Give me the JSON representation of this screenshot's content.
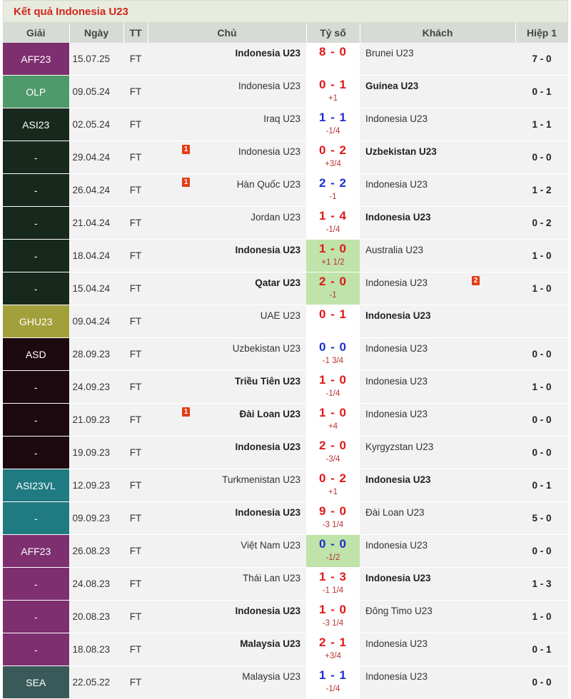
{
  "title": "Kết quả Indonesia U23",
  "headers": {
    "league": "Giải",
    "date": "Ngày",
    "status": "TT",
    "home": "Chủ",
    "score": "Tỷ số",
    "away": "Khách",
    "ht": "Hiệp 1"
  },
  "colors": {
    "title_red": "#d0261b",
    "score_red": "#e01818",
    "score_blue": "#1c2fd4",
    "win_highlight": "#bfe3a8"
  },
  "rows": [
    {
      "league": "AFF23",
      "league_color": "#7d2f6f",
      "date": "15.07.25",
      "status": "FT",
      "home": "Indonesia U23",
      "home_bold": true,
      "home_card": "",
      "score": "8 - 0",
      "score_color": "red",
      "handicap": "",
      "away": "Brunei U23",
      "away_bold": false,
      "away_card": "",
      "ht": "7 - 0",
      "win": false
    },
    {
      "league": "OLP",
      "league_color": "#4e9a6a",
      "date": "09.05.24",
      "status": "FT",
      "home": "Indonesia U23",
      "home_bold": false,
      "home_card": "",
      "score": "0 - 1",
      "score_color": "red",
      "handicap": "+1",
      "away": "Guinea U23",
      "away_bold": true,
      "away_card": "",
      "ht": "0 - 1",
      "win": false
    },
    {
      "league": "ASI23",
      "league_color": "#17291d",
      "date": "02.05.24",
      "status": "FT",
      "home": "Iraq U23",
      "home_bold": false,
      "home_card": "",
      "score": "1 - 1",
      "score_color": "blue",
      "handicap": "-1/4",
      "away": "Indonesia U23",
      "away_bold": false,
      "away_card": "",
      "ht": "1 - 1",
      "win": false
    },
    {
      "league": "-",
      "league_color": "#17291d",
      "date": "29.04.24",
      "status": "FT",
      "home": "Indonesia U23",
      "home_bold": false,
      "home_card": "1",
      "score": "0 - 2",
      "score_color": "red",
      "handicap": "+3/4",
      "away": "Uzbekistan U23",
      "away_bold": true,
      "away_card": "",
      "ht": "0 - 0",
      "win": false
    },
    {
      "league": "-",
      "league_color": "#17291d",
      "date": "26.04.24",
      "status": "FT",
      "home": "Hàn Quốc U23",
      "home_bold": false,
      "home_card": "1",
      "score": "2 - 2",
      "score_color": "blue",
      "handicap": "-1",
      "away": "Indonesia U23",
      "away_bold": false,
      "away_card": "",
      "ht": "1 - 2",
      "win": false
    },
    {
      "league": "-",
      "league_color": "#17291d",
      "date": "21.04.24",
      "status": "FT",
      "home": "Jordan U23",
      "home_bold": false,
      "home_card": "",
      "score": "1 - 4",
      "score_color": "red",
      "handicap": "-1/4",
      "away": "Indonesia U23",
      "away_bold": true,
      "away_card": "",
      "ht": "0 - 2",
      "win": false
    },
    {
      "league": "-",
      "league_color": "#17291d",
      "date": "18.04.24",
      "status": "FT",
      "home": "Indonesia U23",
      "home_bold": true,
      "home_card": "",
      "score": "1 - 0",
      "score_color": "red",
      "handicap": "+1 1/2",
      "away": "Australia U23",
      "away_bold": false,
      "away_card": "",
      "ht": "1 - 0",
      "win": true
    },
    {
      "league": "-",
      "league_color": "#17291d",
      "date": "15.04.24",
      "status": "FT",
      "home": "Qatar U23",
      "home_bold": true,
      "home_card": "",
      "score": "2 - 0",
      "score_color": "red",
      "handicap": "-1",
      "away": "Indonesia U23",
      "away_bold": false,
      "away_card": "2",
      "ht": "1 - 0",
      "win": true
    },
    {
      "league": "GHU23",
      "league_color": "#a2a03a",
      "date": "09.04.24",
      "status": "FT",
      "home": "UAE U23",
      "home_bold": false,
      "home_card": "",
      "score": "0 - 1",
      "score_color": "red",
      "handicap": "",
      "away": "Indonesia U23",
      "away_bold": true,
      "away_card": "",
      "ht": "",
      "win": false
    },
    {
      "league": "ASD",
      "league_color": "#1d0a11",
      "date": "28.09.23",
      "status": "FT",
      "home": "Uzbekistan U23",
      "home_bold": false,
      "home_card": "",
      "score": "0 - 0",
      "score_color": "blue",
      "handicap": "-1 3/4",
      "away": "Indonesia U23",
      "away_bold": false,
      "away_card": "",
      "ht": "0 - 0",
      "win": false
    },
    {
      "league": "-",
      "league_color": "#1d0a11",
      "date": "24.09.23",
      "status": "FT",
      "home": "Triều Tiên U23",
      "home_bold": true,
      "home_card": "",
      "score": "1 - 0",
      "score_color": "red",
      "handicap": "-1/4",
      "away": "Indonesia U23",
      "away_bold": false,
      "away_card": "",
      "ht": "1 - 0",
      "win": false
    },
    {
      "league": "-",
      "league_color": "#1d0a11",
      "date": "21.09.23",
      "status": "FT",
      "home": "Đài Loan U23",
      "home_bold": true,
      "home_card": "1",
      "score": "1 - 0",
      "score_color": "red",
      "handicap": "+4",
      "away": "Indonesia U23",
      "away_bold": false,
      "away_card": "",
      "ht": "0 - 0",
      "win": false
    },
    {
      "league": "-",
      "league_color": "#1d0a11",
      "date": "19.09.23",
      "status": "FT",
      "home": "Indonesia U23",
      "home_bold": true,
      "home_card": "",
      "score": "2 - 0",
      "score_color": "red",
      "handicap": "-3/4",
      "away": "Kyrgyzstan U23",
      "away_bold": false,
      "away_card": "",
      "ht": "0 - 0",
      "win": false
    },
    {
      "league": "ASI23VL",
      "league_color": "#1f7a82",
      "date": "12.09.23",
      "status": "FT",
      "home": "Turkmenistan U23",
      "home_bold": false,
      "home_card": "",
      "score": "0 - 2",
      "score_color": "red",
      "handicap": "+1",
      "away": "Indonesia U23",
      "away_bold": true,
      "away_card": "",
      "ht": "0 - 1",
      "win": false
    },
    {
      "league": "-",
      "league_color": "#1f7a82",
      "date": "09.09.23",
      "status": "FT",
      "home": "Indonesia U23",
      "home_bold": true,
      "home_card": "",
      "score": "9 - 0",
      "score_color": "red",
      "handicap": "-3 1/4",
      "away": "Đài Loan U23",
      "away_bold": false,
      "away_card": "",
      "ht": "5 - 0",
      "win": false
    },
    {
      "league": "AFF23",
      "league_color": "#7d2f6f",
      "date": "26.08.23",
      "status": "FT",
      "home": "Việt Nam U23",
      "home_bold": false,
      "home_card": "",
      "score": "0 - 0",
      "score_color": "blue",
      "handicap": "-1/2",
      "away": "Indonesia U23",
      "away_bold": false,
      "away_card": "",
      "ht": "0 - 0",
      "win": true
    },
    {
      "league": "-",
      "league_color": "#7d2f6f",
      "date": "24.08.23",
      "status": "FT",
      "home": "Thái Lan U23",
      "home_bold": false,
      "home_card": "",
      "score": "1 - 3",
      "score_color": "red",
      "handicap": "-1 1/4",
      "away": "Indonesia U23",
      "away_bold": true,
      "away_card": "",
      "ht": "1 - 3",
      "win": false
    },
    {
      "league": "-",
      "league_color": "#7d2f6f",
      "date": "20.08.23",
      "status": "FT",
      "home": "Indonesia U23",
      "home_bold": true,
      "home_card": "",
      "score": "1 - 0",
      "score_color": "red",
      "handicap": "-3 1/4",
      "away": "Đông Timo U23",
      "away_bold": false,
      "away_card": "",
      "ht": "1 - 0",
      "win": false
    },
    {
      "league": "-",
      "league_color": "#7d2f6f",
      "date": "18.08.23",
      "status": "FT",
      "home": "Malaysia U23",
      "home_bold": true,
      "home_card": "",
      "score": "2 - 1",
      "score_color": "red",
      "handicap": "+3/4",
      "away": "Indonesia U23",
      "away_bold": false,
      "away_card": "",
      "ht": "0 - 1",
      "win": false
    },
    {
      "league": "SEA",
      "league_color": "#3a5a5a",
      "date": "22.05.22",
      "status": "FT",
      "home": "Malaysia U23",
      "home_bold": false,
      "home_card": "",
      "score": "1 - 1",
      "score_color": "blue",
      "handicap": "-1/4",
      "away": "Indonesia U23",
      "away_bold": false,
      "away_card": "",
      "ht": "0 - 0",
      "win": false
    }
  ]
}
